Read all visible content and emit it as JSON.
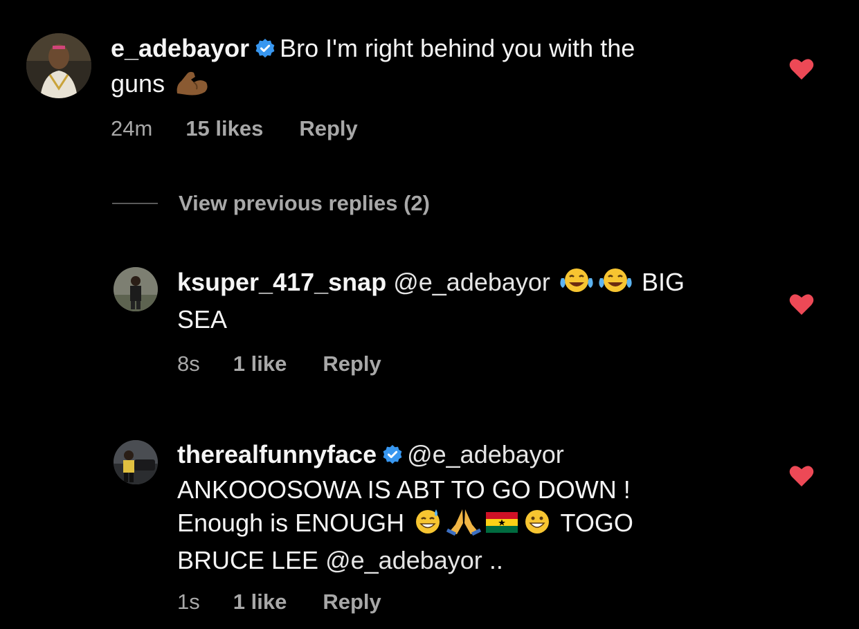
{
  "colors": {
    "background": "#000000",
    "text": "#f5f5f5",
    "muted": "#a8a8a8",
    "heart": "#ed4956",
    "verified": "#3897f0"
  },
  "comments": [
    {
      "username": "e_adebayor",
      "verified": true,
      "text_line1": "Bro I'm right behind you with the",
      "text_line2": "guns",
      "emoji": "flexed-biceps",
      "time": "24m",
      "likes": "15 likes",
      "reply": "Reply",
      "liked": true
    }
  ],
  "view_previous": "View previous replies (2)",
  "replies": [
    {
      "username": "ksuper_417_snap",
      "verified": false,
      "mention": "@e_adebayor",
      "emojis": [
        "face-with-tears-of-joy",
        "face-with-tears-of-joy"
      ],
      "text_tail": "BIG",
      "text_line2": "SEA",
      "time": "8s",
      "likes": "1 like",
      "reply": "Reply",
      "liked": true
    },
    {
      "username": "therealfunnyface",
      "verified": true,
      "mention": "@e_adebayor",
      "text_line2": "ANKOOOSOWA IS ABT TO GO DOWN !",
      "text_line3_start": "Enough is ENOUGH",
      "emojis": [
        "grinning-face-with-sweat",
        "folded-hands",
        "flag-ghana",
        "grinning-face"
      ],
      "text_line3_end": "TOGO",
      "text_line4_start": "BRUCE LEE",
      "text_line4_mention": "@e_adebayor",
      "text_line4_end": "..",
      "time": "1s",
      "likes": "1 like",
      "reply": "Reply",
      "liked": true
    }
  ]
}
